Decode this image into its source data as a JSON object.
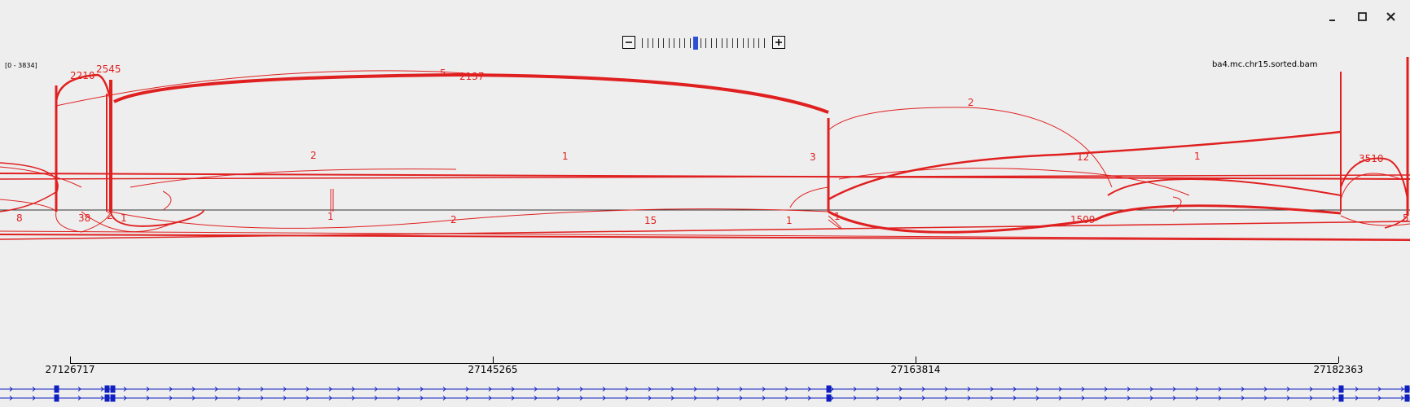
{
  "window": {
    "minimize_icon": "minimize-icon",
    "maximize_icon": "maximize-icon",
    "close_icon": "close-icon"
  },
  "zoom": {
    "minus_icon": "zoom-out-icon",
    "plus_icon": "zoom-in-icon",
    "levels": 24,
    "selected_level": 10
  },
  "track": {
    "data_range": "[0 - 3834]",
    "name": "ba4.mc.chr15.sorted.bam",
    "color": "#e02020"
  },
  "junction_labels": [
    "2210",
    "2545",
    "5",
    "2137",
    "2",
    "2",
    "1",
    "3",
    "12",
    "1",
    "3510",
    "8",
    "38",
    "2",
    "1",
    "1",
    "2",
    "15",
    "1",
    "1",
    "1509",
    "5"
  ],
  "ruler": {
    "positions": [
      "27126717",
      "27145265",
      "27163814",
      "27182363"
    ]
  },
  "gene_track": {
    "color": "#1020c0"
  }
}
